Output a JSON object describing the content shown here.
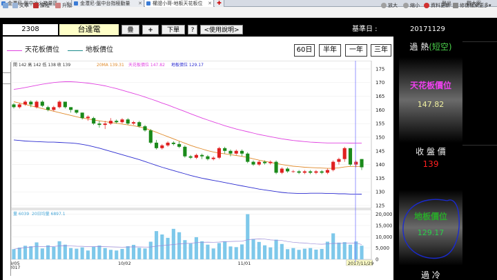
{
  "tabs": [
    {
      "label": "金灃尼-盤中冰火箱量區",
      "active": false
    },
    {
      "label": "金灃尼-盤中台指極動量",
      "active": false
    },
    {
      "label": "權證小哥-地板天花板位",
      "active": true
    }
  ],
  "tab_right": {
    "logout": "登出",
    "watch": "觀大案"
  },
  "menu": {
    "left": [
      "文章",
      "課程",
      "升級"
    ],
    "right": [
      "放大",
      "縮小",
      "資料更新",
      "修復檔案",
      "更多"
    ]
  },
  "info": {
    "code": "2308",
    "name": "台達電",
    "btn_overlay": "疊",
    "btn_add": "+",
    "btn_order": "下單",
    "btn_help": "?",
    "btn_manual": "<使用說明>",
    "date_label": "基準日 :",
    "date_value": "20171129"
  },
  "legend": {
    "ceiling": "天花板價位",
    "floor": "地板價位",
    "ceiling_color": "#e040e0",
    "floor_color": "#1a8a8a"
  },
  "range_buttons": [
    "60日",
    "半年",
    "一年",
    "三年"
  ],
  "chart_header": {
    "ohlc": "開 142 高 142 低 138 收 139",
    "ma": "20MA 139.31",
    "ceiling": "天花板價位 147.82",
    "floor": "地板價位 129.17"
  },
  "volume_header": {
    "vol": "量 6039",
    "avg": "20日均量 6897.1"
  },
  "side": {
    "status_a": "過",
    "status_b": "熱",
    "status_paren": "(短空)",
    "ceiling_label": "天花板價位",
    "ceiling_value": "147.82",
    "close_label": "收 盤 價",
    "close_value": "139",
    "floor_label": "地板價位",
    "floor_value": "129.17",
    "bottom_label": "過 冷"
  },
  "chart_data": {
    "type": "candlestick",
    "x_tick_labels": [
      {
        "label": "9/05",
        "sub": "2017",
        "index": 0
      },
      {
        "label": "10/02",
        "index": 19
      },
      {
        "label": "11/01",
        "index": 40
      },
      {
        "label": "2017/11/29",
        "index": 60
      }
    ],
    "price_ylim": [
      125,
      177
    ],
    "price_ticks": [
      125,
      130,
      135,
      140,
      145,
      150,
      155,
      160,
      165,
      170,
      175
    ],
    "volume_ylim": [
      0,
      22000
    ],
    "volume_ticks": [
      "0",
      "5,000",
      "10,000",
      "15,000",
      "20,000"
    ],
    "volume_tick_values": [
      0,
      5000,
      10000,
      15000,
      20000
    ],
    "candles": [
      [
        162,
        161,
        162.5,
        160.5
      ],
      [
        161,
        162,
        162.5,
        160.5
      ],
      [
        162,
        163,
        163.5,
        161.5
      ],
      [
        163,
        162,
        163.5,
        161
      ],
      [
        161,
        163,
        163.5,
        160.5
      ],
      [
        163,
        161.5,
        163.5,
        161
      ],
      [
        161,
        160,
        161.5,
        159.5
      ],
      [
        160,
        161,
        161.5,
        159.5
      ],
      [
        161,
        163,
        163.5,
        160.5
      ],
      [
        163,
        161,
        163,
        160.5
      ],
      [
        161,
        160,
        161,
        159
      ],
      [
        160,
        159,
        160,
        158.5
      ],
      [
        159,
        157,
        159,
        156.5
      ],
      [
        157,
        157.5,
        158,
        156
      ],
      [
        157,
        155,
        157.5,
        154.5
      ],
      [
        155,
        154.5,
        156,
        153.5
      ],
      [
        154.5,
        155,
        156,
        153
      ],
      [
        155,
        156,
        157,
        154.5
      ],
      [
        156,
        155.5,
        156.5,
        155
      ],
      [
        155.5,
        156.5,
        157,
        155
      ],
      [
        156.5,
        155,
        157,
        154.5
      ],
      [
        155,
        155.5,
        156,
        154.5
      ],
      [
        155.5,
        154,
        156,
        153.5
      ],
      [
        154,
        152.5,
        154.5,
        152
      ],
      [
        152.5,
        148,
        153,
        147.5
      ],
      [
        148,
        146,
        149,
        145.5
      ],
      [
        146,
        147,
        147.5,
        145.5
      ],
      [
        147,
        148,
        148.5,
        146.5
      ],
      [
        148,
        147.5,
        148.5,
        147
      ],
      [
        147.5,
        146.5,
        148.5,
        146
      ],
      [
        146.5,
        143,
        147,
        142.5
      ],
      [
        143,
        142.5,
        143.5,
        142
      ],
      [
        142.5,
        143.5,
        144,
        142
      ],
      [
        143.5,
        143,
        144,
        142
      ],
      [
        143,
        142,
        143.5,
        141.5
      ],
      [
        142,
        142.5,
        143,
        141.5
      ],
      [
        142.5,
        146,
        146.5,
        142
      ],
      [
        146,
        145,
        146.5,
        144
      ],
      [
        145,
        144,
        145.5,
        143
      ],
      [
        144,
        145,
        145.5,
        143.5
      ],
      [
        145,
        144,
        145.5,
        143
      ],
      [
        144,
        141,
        144.5,
        140.5
      ],
      [
        141,
        140,
        141.5,
        139.5
      ],
      [
        140,
        141,
        141.5,
        139.5
      ],
      [
        141,
        140.5,
        141.5,
        140
      ],
      [
        140.5,
        141,
        141.5,
        140
      ],
      [
        141,
        137,
        141.5,
        136.5
      ],
      [
        137,
        138.5,
        139,
        136.5
      ],
      [
        138.5,
        137.5,
        139,
        137
      ],
      [
        137.5,
        137.5,
        138,
        137
      ],
      [
        137.5,
        137,
        138,
        136.5
      ],
      [
        137,
        137.5,
        138,
        136.5
      ],
      [
        137.5,
        137,
        138,
        136.5
      ],
      [
        137,
        137.5,
        138,
        136.5
      ],
      [
        137.5,
        137,
        138,
        136.5
      ],
      [
        137,
        138,
        138.5,
        136.5
      ],
      [
        138,
        141,
        141.5,
        137.5
      ],
      [
        141,
        142,
        142.5,
        140
      ],
      [
        142,
        146,
        146.5,
        141
      ],
      [
        146,
        140,
        146,
        139.5
      ],
      [
        140,
        141,
        141.5,
        139
      ],
      [
        142,
        139,
        142,
        138
      ]
    ],
    "ma20": [
      163,
      162.5,
      162,
      161.5,
      161,
      160.5,
      160,
      159.5,
      159,
      158.5,
      158,
      157.5,
      157,
      156.7,
      156.3,
      156,
      155.7,
      155.4,
      155.1,
      154.8,
      154.5,
      154.2,
      153.8,
      153.3,
      152.6,
      151.8,
      151,
      150.2,
      149.4,
      148.6,
      147.8,
      147,
      146.3,
      145.7,
      145.1,
      144.6,
      144.2,
      143.9,
      143.6,
      143.3,
      143,
      142.6,
      142.1,
      141.6,
      141.2,
      140.8,
      140.4,
      140,
      139.7,
      139.4,
      139.2,
      139,
      138.9,
      138.8,
      138.7,
      138.6,
      138.6,
      138.8,
      139.1,
      139.3,
      139.3,
      139.31
    ],
    "ceiling": [
      167.5,
      167.8,
      168.2,
      168.6,
      169,
      169.4,
      169.7,
      170,
      170.2,
      170.3,
      170.3,
      170.2,
      170,
      169.8,
      169.5,
      169.2,
      168.8,
      168.3,
      167.8,
      167.2,
      166.6,
      166,
      165.4,
      164.7,
      164,
      163.3,
      162.5,
      161.8,
      161,
      160.2,
      159.4,
      158.6,
      157.8,
      157,
      156.3,
      155.6,
      154.9,
      154.2,
      153.6,
      153,
      152.5,
      152,
      151.5,
      151,
      150.6,
      150.2,
      149.8,
      149.4,
      149.1,
      148.8,
      148.6,
      148.4,
      148.2,
      148.1,
      148,
      147.9,
      147.9,
      147.9,
      147.9,
      147.85,
      147.83,
      147.82
    ],
    "floor": [
      149,
      148.8,
      148.6,
      148.5,
      148.4,
      148.3,
      148.2,
      148.2,
      148.1,
      148,
      147.9,
      147.7,
      147.4,
      147,
      146.5,
      146,
      145.4,
      144.8,
      144.2,
      143.6,
      143,
      142.4,
      141.8,
      141.1,
      140.4,
      139.7,
      139,
      138.4,
      137.8,
      137.2,
      136.6,
      136,
      135.5,
      135,
      134.6,
      134.2,
      133.8,
      133.4,
      133,
      132.6,
      132.2,
      131.8,
      131.4,
      131,
      130.7,
      130.4,
      130.1,
      129.8,
      129.6,
      129.5,
      129.4,
      129.4,
      129.5,
      129.5,
      129.5,
      129.4,
      129.4,
      129.3,
      129.3,
      129.2,
      129.2,
      129.17
    ],
    "volume": [
      4500,
      5200,
      6000,
      5800,
      7500,
      4800,
      6200,
      5500,
      8000,
      6500,
      5000,
      4700,
      5300,
      3900,
      5600,
      6100,
      5000,
      4200,
      3900,
      4600,
      5800,
      6400,
      5100,
      4800,
      7800,
      12500,
      11000,
      9500,
      13500,
      12000,
      8500,
      7000,
      9800,
      8000,
      6500,
      4800,
      7200,
      8000,
      5700,
      5400,
      6600,
      20000,
      9000,
      7700,
      6200,
      5300,
      8700,
      6800,
      4500,
      5000,
      4200,
      4700,
      5000,
      4300,
      4600,
      7800,
      11500,
      7400,
      7600,
      6500,
      7900,
      6039
    ]
  }
}
